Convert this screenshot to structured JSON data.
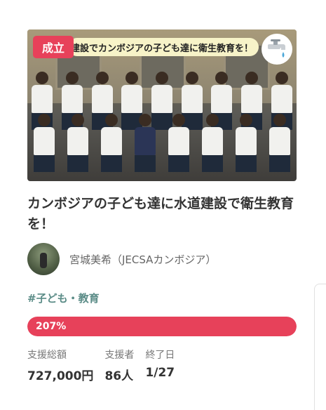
{
  "project": {
    "status_badge": "成立",
    "image_banner": "建設でカンボジアの子ども達に衛生教育を！",
    "title": "カンボジアの子ども達に水道建設で衛生教育を！",
    "owner_name": "宮城美希（JECSAカンボジア）",
    "tag": "#子ども・教育",
    "progress_percent_label": "207%",
    "progress_fraction": 1.0,
    "stats": {
      "total_label": "支援総額",
      "total_value": "727,000円",
      "supporters_label": "支援者",
      "supporters_value": "86人",
      "end_label": "終了日",
      "end_value": "1/27"
    }
  },
  "colors": {
    "accent": "#e7415a",
    "tag": "#5b8c87",
    "banner_bg": "#f7f3c8"
  },
  "icons": [
    "faucet-icon"
  ]
}
